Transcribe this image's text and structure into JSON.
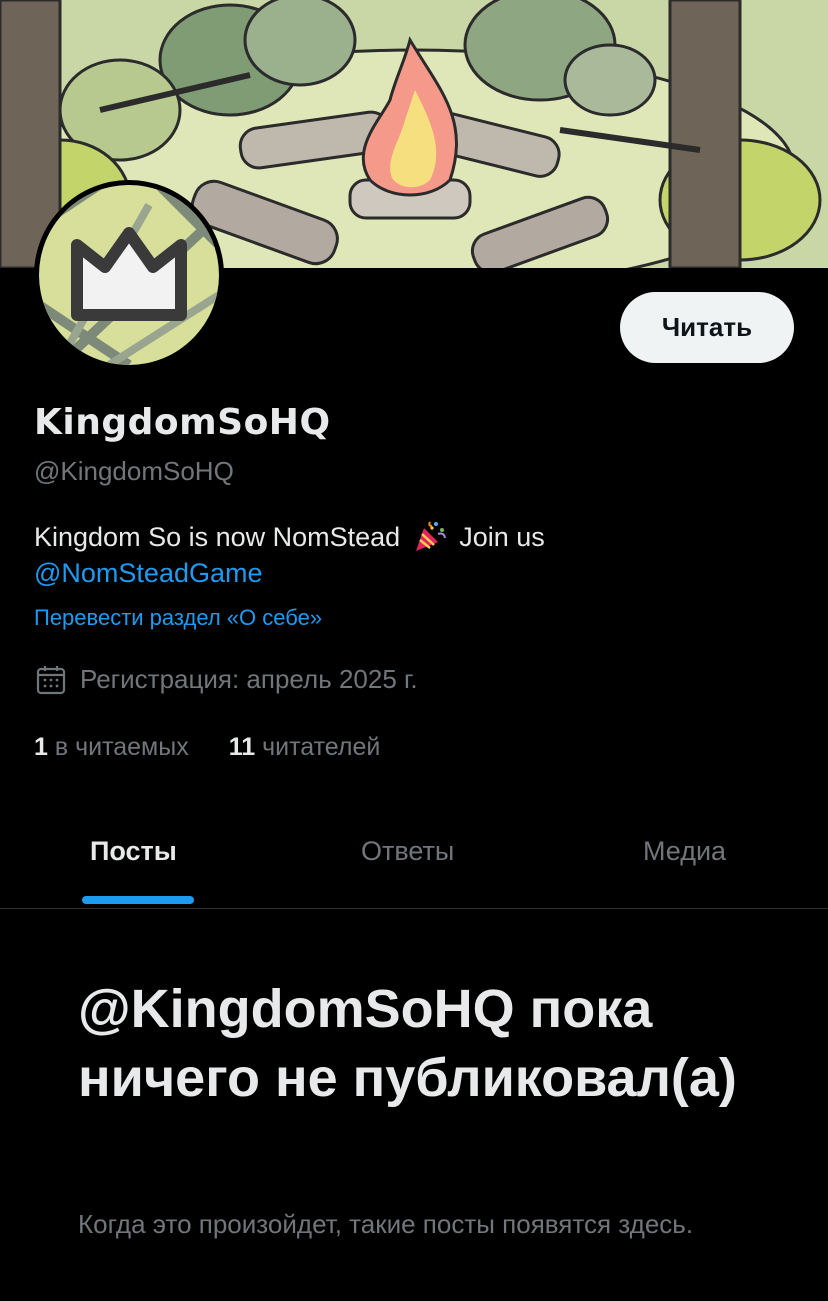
{
  "banner": {
    "description_icon": "campfire-forest-banner"
  },
  "avatar": {
    "icon": "crown-icon"
  },
  "profile": {
    "follow_label": "Читать",
    "display_name": "KingdomSoHQ",
    "handle": "@KingdomSoHQ",
    "bio_text": "Kingdom So is now NomStead",
    "bio_join": "Join us",
    "bio_mention": "@NomSteadGame",
    "translate_label": "Перевести раздел «О себе»",
    "joined": "Регистрация: апрель 2025 г."
  },
  "stats": {
    "following_count": "1",
    "following_label": "в читаемых",
    "followers_count": "11",
    "followers_label": "читателей"
  },
  "tabs": [
    {
      "label": "Посты",
      "active": true
    },
    {
      "label": "Ответы",
      "active": false
    },
    {
      "label": "Медиа",
      "active": false
    }
  ],
  "empty_state": {
    "title": "@KingdomSoHQ пока ничего не публиковал(а)",
    "subtitle": "Когда это произойдет, такие посты появятся здесь."
  },
  "colors": {
    "background": "#000000",
    "accent": "#1d9bf0",
    "text_primary": "#e7e9ea",
    "text_secondary": "#71767b"
  }
}
